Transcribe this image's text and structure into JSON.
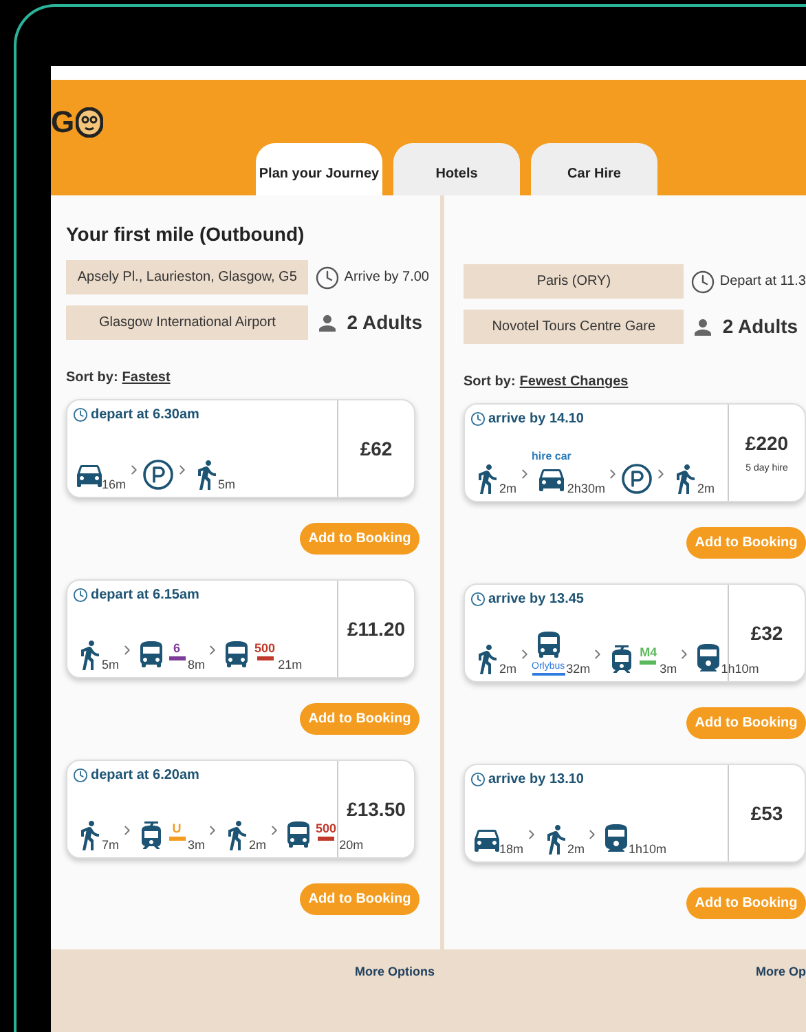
{
  "logo": {
    "text": "G"
  },
  "tabs": [
    {
      "label": "Plan your Journey",
      "selected": true
    },
    {
      "label": "Hotels",
      "selected": false
    },
    {
      "label": "Car Hire",
      "selected": false
    }
  ],
  "panels": [
    {
      "heading": "Your first  mile (Outbound)",
      "fields": [
        "Apsely Pl., Laurieston, Glasgow, G5",
        "Glasgow International Airport"
      ],
      "time": "Arrive by 7.00",
      "passengers": "2 Adults",
      "sort_label": "Sort by:",
      "sort_value": "Fastest",
      "more": "More Options",
      "options": [
        {
          "time": "depart at 6.30am",
          "price": "£62",
          "button": "Add to Booking",
          "legs": [
            {
              "kind": "car",
              "duration": "16m"
            },
            {
              "kind": "parking"
            },
            {
              "kind": "walk",
              "duration": "5m"
            }
          ]
        },
        {
          "time": "depart at 6.15am",
          "price": "£11.20",
          "button": "Add to Booking",
          "legs": [
            {
              "kind": "walk",
              "duration": "5m"
            },
            {
              "kind": "bus",
              "line": {
                "text": "6",
                "color": "#7d3c98"
              },
              "duration": "8m"
            },
            {
              "kind": "bus",
              "line": {
                "text": "500",
                "color": "#c0392b"
              },
              "duration": "21m"
            }
          ]
        },
        {
          "time": "depart at 6.20am",
          "price": "£13.50",
          "button": "Add to Booking",
          "legs": [
            {
              "kind": "walk",
              "duration": "7m"
            },
            {
              "kind": "metro",
              "line": {
                "text": "U",
                "color": "#f39c1f"
              },
              "duration": "3m"
            },
            {
              "kind": "walk",
              "duration": "2m"
            },
            {
              "kind": "bus",
              "line": {
                "text": "500",
                "color": "#c0392b"
              },
              "duration": "20m"
            }
          ]
        }
      ]
    },
    {
      "fields": [
        "Paris (ORY)",
        "Novotel Tours Centre Gare"
      ],
      "time": "Depart at 11.3",
      "passengers": "2 Adults",
      "sort_label": "Sort by:",
      "sort_value": "Fewest Changes",
      "more": "More Op",
      "options": [
        {
          "time": "arrive by 14.10",
          "price": "£220",
          "price_note": "5 day hire",
          "button": "Add to Booking",
          "legs": [
            {
              "kind": "walk",
              "duration": "2m"
            },
            {
              "kind": "car",
              "label_top": "hire car",
              "duration": "2h30m"
            },
            {
              "kind": "parking"
            },
            {
              "kind": "walk",
              "duration": "2m"
            }
          ]
        },
        {
          "time": "arrive by 13.45",
          "price": "£32",
          "button": "Add to Booking",
          "legs": [
            {
              "kind": "walk",
              "duration": "2m"
            },
            {
              "kind": "bus",
              "operator": "Orlybus",
              "duration": "32m"
            },
            {
              "kind": "metro",
              "line": {
                "text": "M4",
                "color": "#5cb85c"
              },
              "duration": "3m"
            },
            {
              "kind": "train",
              "duration": "1h10m"
            }
          ]
        },
        {
          "time": "arrive by 13.10",
          "price": "£53",
          "button": "Add to Booking",
          "legs": [
            {
              "kind": "car",
              "duration": "18m"
            },
            {
              "kind": "walk",
              "duration": "2m"
            },
            {
              "kind": "train",
              "duration": "1h10m"
            }
          ]
        }
      ]
    }
  ]
}
